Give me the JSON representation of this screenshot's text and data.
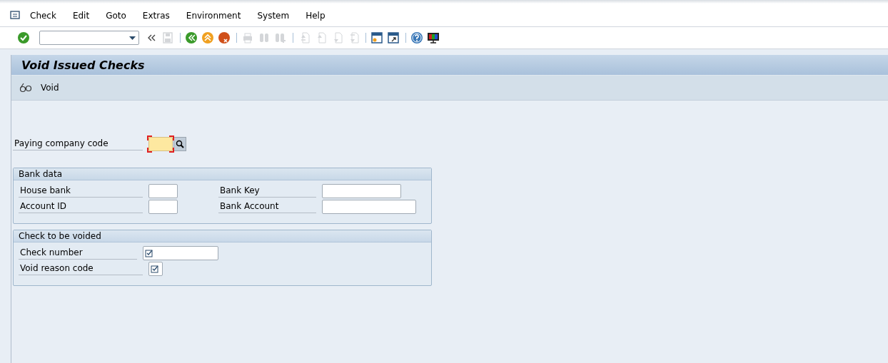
{
  "menu_bar": [
    "Check",
    "Edit",
    "Goto",
    "Extras",
    "Environment",
    "System",
    "Help"
  ],
  "toolbar": [
    {
      "kind": "enter",
      "disabled": false
    },
    {
      "kind": "command-field"
    },
    {
      "kind": "collapse",
      "disabled": false
    },
    {
      "kind": "save",
      "disabled": true
    },
    {
      "kind": "separator"
    },
    {
      "kind": "back",
      "disabled": false
    },
    {
      "kind": "exit",
      "disabled": false
    },
    {
      "kind": "cancel",
      "disabled": false
    },
    {
      "kind": "separator"
    },
    {
      "kind": "print",
      "disabled": true
    },
    {
      "kind": "find",
      "disabled": true
    },
    {
      "kind": "find-next",
      "disabled": true
    },
    {
      "kind": "separator"
    },
    {
      "kind": "first-page",
      "disabled": true
    },
    {
      "kind": "prev-page",
      "disabled": true
    },
    {
      "kind": "next-page",
      "disabled": true
    },
    {
      "kind": "last-page",
      "disabled": true
    },
    {
      "kind": "separator"
    },
    {
      "kind": "new-session",
      "disabled": false
    },
    {
      "kind": "shortcut",
      "disabled": false
    },
    {
      "kind": "separator"
    },
    {
      "kind": "help",
      "disabled": false
    },
    {
      "kind": "layout",
      "disabled": false
    }
  ],
  "title": "Void Issued Checks",
  "app_toolbar": [
    {
      "label": "Void"
    }
  ],
  "header_field": {
    "label": "Paying company code",
    "kind": "required",
    "search_help": true
  },
  "groups": [
    {
      "title": "Bank data",
      "rows": [
        [
          {
            "label": "House bank",
            "kind": "plain"
          },
          {
            "label": "Bank Key",
            "kind": "plain"
          }
        ],
        [
          {
            "label": "Account ID",
            "kind": "plain"
          },
          {
            "label": "Bank Account",
            "kind": "plain"
          }
        ]
      ]
    },
    {
      "title": "Check to be voided",
      "rows": [
        [
          {
            "label": "Check number",
            "kind": "check"
          }
        ],
        [
          {
            "label": "Void reason code",
            "kind": "check"
          }
        ]
      ]
    }
  ]
}
